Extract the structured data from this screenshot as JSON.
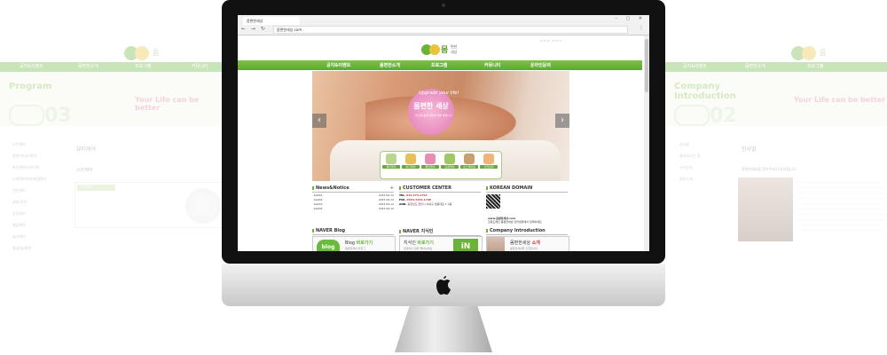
{
  "left_bg": {
    "nav": [
      "공지&이벤트",
      "몸편한소개",
      "프로그램",
      "커뮤니티"
    ],
    "title": [
      "Program"
    ],
    "num": "03",
    "slogan": "Your Life can be better",
    "side": [
      "스킨케어",
      "발관리/다리관리",
      "바디관리/다이어트",
      "노화관리/피부재생관리",
      "전신관리",
      "부항/경락",
      "산후관리",
      "웨딩케어",
      "남성케어",
      "얼굴/등/골반"
    ],
    "section": "뷰티케어",
    "sub": "스킨케어",
    "box_title": "스킨케어"
  },
  "right_bg": {
    "nav": [
      "공지&이벤트",
      "몸편한소개",
      "프로그램"
    ],
    "title": [
      "Company",
      "Introduction"
    ],
    "num": "02",
    "slogan": "Your Life can be better",
    "side": [
      "인사말",
      "찾아오시는 길",
      "오시는길",
      "원장소개"
    ],
    "section": "인사말",
    "greeting": "몸편한세상을 찾아주셔서 감사합니다."
  },
  "browser": {
    "tab": "몸편한세상",
    "url": "몸편한세상.com",
    "win_buttons": "– ▢ ✕"
  },
  "site": {
    "toplinks": "▭▭▭  ▭▭▭",
    "logo_text": "몸편한세상",
    "nav": [
      "공지&이벤트",
      "몸편한소개",
      "프로그램",
      "커뮤니티",
      "온라인문의"
    ],
    "slider": {
      "tagline": "Upgrade your life!",
      "name": "몸편한 세상",
      "desc": "당신의 몸이 편안하기를 바랍니다",
      "prev": "‹",
      "next": "›",
      "icons": [
        "뷰티케어",
        "바디케어",
        "웨딩케어",
        "남성케어",
        "홈스케어링",
        "산전관리"
      ]
    },
    "news": {
      "title": "News&Notice",
      "plus": "+",
      "items": [
        {
          "t": "test01",
          "d": "2015.09.12"
        },
        {
          "t": "test02",
          "d": "2015.09.12"
        },
        {
          "t": "test03",
          "d": "2015.09.12"
        },
        {
          "t": "test04",
          "d": "2015.09.12"
        }
      ]
    },
    "customer": {
      "title": "CUSTOMER CENTER",
      "tel_label": "TEL.",
      "tel": "041-573-1793",
      "fax_label": "FAX.",
      "fax": "0303-3442-1798",
      "add_label": "ADD.",
      "add": "충청남도 천안시 서북구 쌍용대로 1 3층"
    },
    "domain": {
      "title": "KOREAN DOMAIN",
      "url": "www.몸편한세상.com",
      "desc": "한글도메인 몸편한세상 인터넷창에서 입력하세요"
    },
    "blog": {
      "title": "NAVER Blog",
      "badge": "blog",
      "link_a": "Blog",
      "link_b": "바로가기",
      "sub": "몸편한세상 블로그"
    },
    "kin": {
      "title": "NAVER 지식인",
      "link_a": "지식인",
      "link_b": "바로가기",
      "sub": "궁금하신 점을 물어보세요",
      "badge": "iN"
    },
    "company": {
      "title": "Company Introduction",
      "link_a": "몸편한세상",
      "link_b": "소개",
      "sub": "몸편한세상을 소개합니다"
    }
  }
}
